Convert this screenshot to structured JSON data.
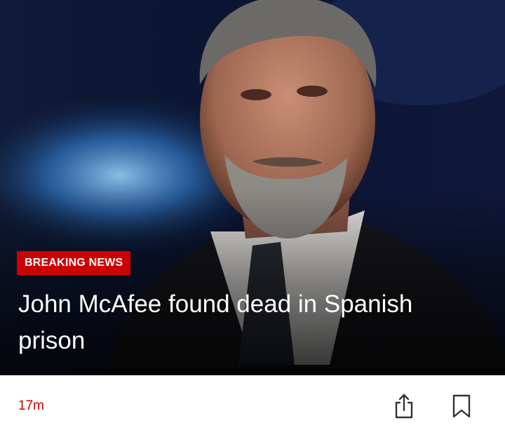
{
  "article": {
    "badge": "BREAKING NEWS",
    "headline": "John McAfee found dead in Spanish prison",
    "time_ago": "17m",
    "image": "portrait-photo"
  },
  "actions": {
    "share_icon": "share-icon",
    "bookmark_icon": "bookmark-icon"
  },
  "colors": {
    "accent": "#cc0000",
    "icon": "#333333",
    "headline_text": "#ffffff"
  }
}
